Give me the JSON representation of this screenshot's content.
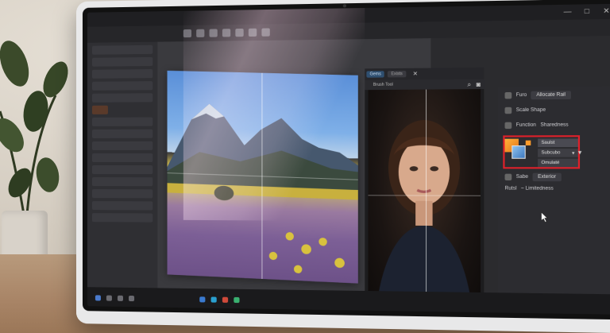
{
  "app": {
    "title": "",
    "window_controls": [
      "—",
      "□",
      "✕"
    ]
  },
  "document_tabs": {
    "tab1": "Gems",
    "tab2": "Exists",
    "header": "Brush Tool"
  },
  "right_panel": {
    "row1": {
      "label": "Furo",
      "value": "Allocate Rail"
    },
    "row2": {
      "label": "Scale Shape"
    },
    "row3": {
      "label": "Function",
      "value": "Sharedness"
    },
    "dropdown": {
      "option_selected": "Saulst",
      "option_2": "Subcubo",
      "option_3": "Omulaté"
    },
    "row4": {
      "label": "Sabe",
      "value": "Exterior"
    },
    "row5": {
      "label": "Rutsl",
      "value": "~ Limitedness"
    }
  },
  "colors": {
    "accent_highlight": "#e0202a",
    "tab_active": "#2f4f70",
    "swatch_foreground": "#ffb23a",
    "swatch_background": "#8fc2ee"
  }
}
